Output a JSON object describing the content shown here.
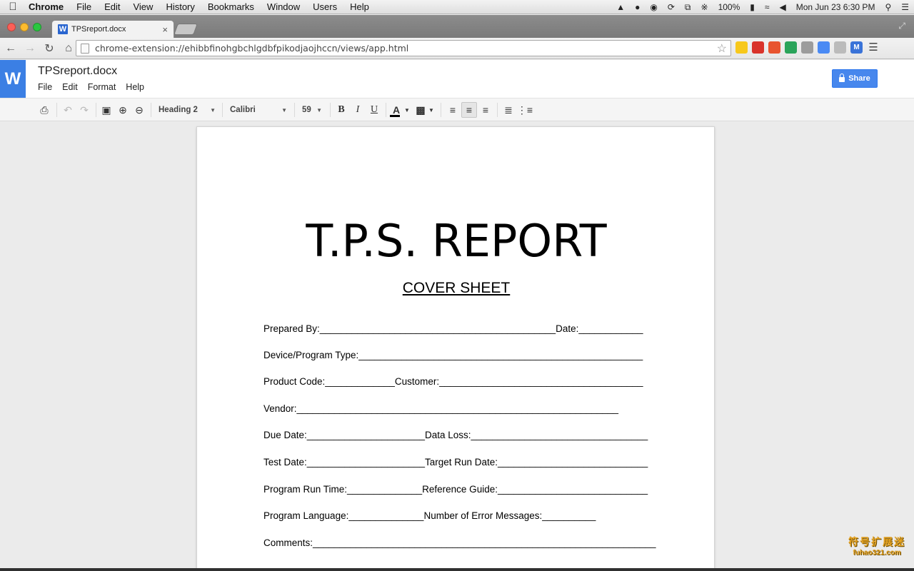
{
  "macbar": {
    "app": "Chrome",
    "menus": [
      "File",
      "Edit",
      "View",
      "History",
      "Bookmarks",
      "Window",
      "Users",
      "Help"
    ],
    "battery": "100%",
    "datetime": "Mon Jun 23  6:30 PM"
  },
  "browser": {
    "tab_title": "TPSreport.docx",
    "tab_favicon": "W",
    "url": "chrome-extension://ehibbfinohgbchlgdbfpikodjaojhccn/views/app.html"
  },
  "app": {
    "logo": "W",
    "doc_title": "TPSreport.docx",
    "menus": [
      "File",
      "Edit",
      "Format",
      "Help"
    ],
    "share_label": "Share"
  },
  "format": {
    "style": "Heading 2",
    "font": "Calibri",
    "size": "59",
    "bold": "B",
    "italic": "I",
    "underline": "U",
    "text_color": "A"
  },
  "document": {
    "title": "T.P.S. REPORT",
    "subtitle": "COVER SHEET",
    "lines": [
      "Prepared By:____________________________________________Date:____________",
      "Device/Program Type:_____________________________________________________",
      "Product Code:_____________Customer:______________________________________",
      "Vendor:____________________________________________________________",
      "Due Date:______________________Data Loss:_________________________________",
      "Test Date:______________________Target Run Date:____________________________",
      "Program Run Time:______________Reference Guide:____________________________",
      "Program Language:______________Number of Error Messages:__________",
      "Comments:________________________________________________________________"
    ]
  },
  "watermark": {
    "cn": "符号扩展迷",
    "en": "fuhao321.com"
  },
  "colors": {
    "app_blue": "#3b7fe4",
    "share_blue": "#4787ed"
  }
}
